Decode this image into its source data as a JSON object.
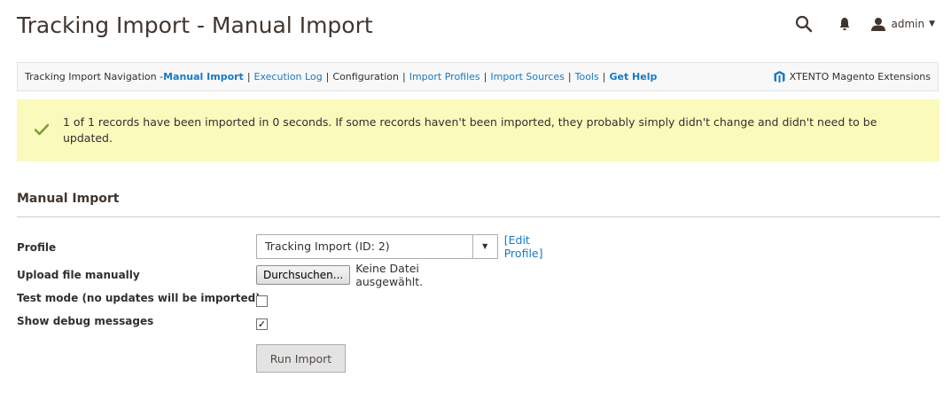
{
  "header": {
    "title": "Tracking Import - Manual Import",
    "user": "admin"
  },
  "nav": {
    "prefix": "Tracking Import Navigation - ",
    "items": [
      {
        "label": "Manual Import"
      },
      {
        "label": "Execution Log"
      },
      {
        "label": "Configuration"
      },
      {
        "label": "Import Profiles"
      },
      {
        "label": "Import Sources"
      },
      {
        "label": "Tools"
      },
      {
        "label": "Get Help"
      }
    ],
    "separator": "|",
    "brand": "XTENTO Magento Extensions"
  },
  "message": {
    "text": "1 of 1 records have been imported in 0 seconds. If some records haven't been imported, they probably simply didn't change and didn't need to be updated."
  },
  "section": {
    "title": "Manual Import"
  },
  "form": {
    "profile_label": "Profile",
    "profile_value": "Tracking Import (ID: 2)",
    "edit_profile": "[Edit Profile]",
    "upload_label": "Upload file manually",
    "browse_button": "Durchsuchen...",
    "file_status": "Keine Datei ausgewählt.",
    "test_mode_label": "Test mode (no updates will be imported)",
    "test_mode_checked": false,
    "debug_label": "Show debug messages",
    "debug_checked": true,
    "run_button": "Run Import"
  },
  "colors": {
    "link": "#1979c3",
    "message_bg": "#fafabc",
    "success": "#79a22e"
  },
  "icons": {
    "search": "search-icon",
    "notifications": "bell-icon",
    "user": "user-icon",
    "success": "checkmark-icon",
    "brand": "xtento-logo-icon"
  }
}
